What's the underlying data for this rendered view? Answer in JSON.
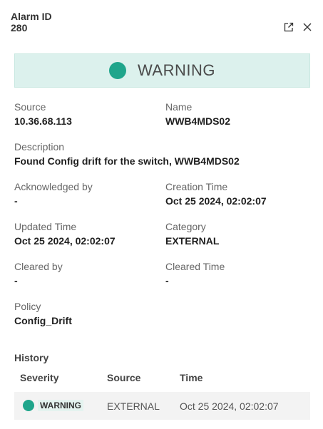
{
  "header": {
    "title": "Alarm ID",
    "id": "280"
  },
  "icons": {
    "open_external": "open-in-new-icon",
    "close": "close-icon"
  },
  "banner": {
    "severity": "WARNING",
    "color": "#1fa58b"
  },
  "fields": {
    "source": {
      "label": "Source",
      "value": "10.36.68.113"
    },
    "name": {
      "label": "Name",
      "value": "WWB4MDS02"
    },
    "description": {
      "label": "Description",
      "value": "Found Config drift for the switch, WWB4MDS02"
    },
    "acknowledged_by": {
      "label": "Acknowledged by",
      "value": "-"
    },
    "creation_time": {
      "label": "Creation Time",
      "value": "Oct 25 2024, 02:02:07"
    },
    "updated_time": {
      "label": "Updated Time",
      "value": "Oct 25 2024, 02:02:07"
    },
    "category": {
      "label": "Category",
      "value": "EXTERNAL"
    },
    "cleared_by": {
      "label": "Cleared by",
      "value": "-"
    },
    "cleared_time": {
      "label": "Cleared Time",
      "value": "-"
    },
    "policy": {
      "label": "Policy",
      "value": "Config_Drift"
    }
  },
  "history": {
    "title": "History",
    "columns": [
      "Severity",
      "Source",
      "Time"
    ],
    "rows": [
      {
        "severity": "WARNING",
        "source": "EXTERNAL",
        "time": "Oct 25 2024, 02:02:07"
      }
    ]
  }
}
